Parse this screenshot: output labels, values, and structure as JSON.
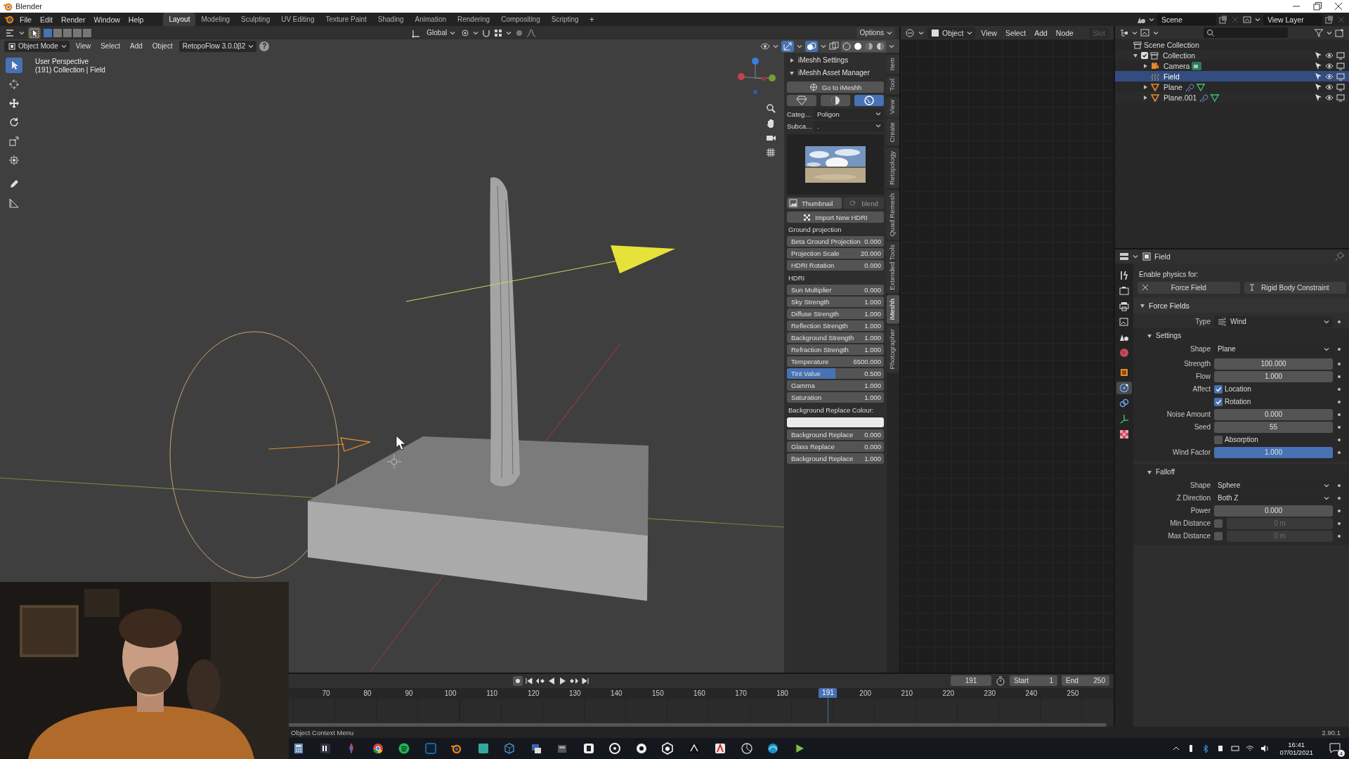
{
  "window": {
    "title": "Blender"
  },
  "menu": [
    "File",
    "Edit",
    "Render",
    "Window",
    "Help"
  ],
  "workspaces": [
    {
      "label": "Layout",
      "selected": true
    },
    {
      "label": "Modeling",
      "selected": false
    },
    {
      "label": "Sculpting",
      "selected": false
    },
    {
      "label": "UV Editing",
      "selected": false
    },
    {
      "label": "Texture Paint",
      "selected": false
    },
    {
      "label": "Shading",
      "selected": false
    },
    {
      "label": "Animation",
      "selected": false
    },
    {
      "label": "Rendering",
      "selected": false
    },
    {
      "label": "Compositing",
      "selected": false
    },
    {
      "label": "Scripting",
      "selected": false
    }
  ],
  "add_workspace": "+",
  "scene_selector": {
    "scene": "Scene",
    "view_layer": "View Layer"
  },
  "tool_header": {
    "orientation": "Global",
    "options": "Options"
  },
  "viewport_header": {
    "mode": "Object Mode",
    "menus": [
      "View",
      "Select",
      "Add",
      "Object"
    ],
    "addon": "RetopoFlow 3.0.0β2",
    "help": "?"
  },
  "viewport": {
    "view_name": "User Perspective",
    "collection": "(191) Collection | Field",
    "tools": [
      {
        "kind": "select",
        "selected": true
      },
      {
        "kind": "cursor",
        "selected": false
      },
      {
        "kind": "move",
        "selected": false
      },
      {
        "kind": "rotate",
        "selected": false
      },
      {
        "kind": "scale",
        "selected": false
      },
      {
        "kind": "transform",
        "selected": false
      },
      {
        "kind": "annotate",
        "selected": false
      },
      {
        "kind": "measure",
        "selected": false
      }
    ]
  },
  "sidebar": {
    "tabs": [
      {
        "label": "Item",
        "selected": false
      },
      {
        "label": "Tool",
        "selected": false
      },
      {
        "label": "View",
        "selected": false
      },
      {
        "label": "Create",
        "selected": false
      },
      {
        "label": "Retopology",
        "selected": false
      },
      {
        "label": "Quad Remesh",
        "selected": false
      },
      {
        "label": "Extended Tools",
        "selected": false
      },
      {
        "label": "iMeshh",
        "selected": true
      },
      {
        "label": "Photographer",
        "selected": false
      }
    ],
    "panels": [
      {
        "title": "iMeshh Settings",
        "expanded": false
      },
      {
        "title": "iMeshh Asset Manager",
        "expanded": true
      }
    ],
    "go_button": "Go to iMeshh",
    "asset_types": [
      {
        "kind": "model",
        "selected": false
      },
      {
        "kind": "material",
        "selected": false
      },
      {
        "kind": "hdri",
        "selected": true
      }
    ],
    "category": {
      "label": "Categ…",
      "value": "Poligon"
    },
    "subcategory": {
      "label": "Subca…",
      "value": "."
    },
    "thumbnail": {
      "kind": "picture",
      "label": "Thumbnail"
    },
    "blend": {
      "label": "blend",
      "disabled": true
    },
    "import_button": "Import New HDRI",
    "sections": [
      {
        "title": "Ground projection",
        "fields": [
          {
            "kind": "number",
            "label": "Beta Ground Projection",
            "value": "0.000"
          },
          {
            "kind": "number",
            "label": "Projection Scale",
            "value": "20.000"
          },
          {
            "kind": "number",
            "label": "HDRI Rotation",
            "value": "0.000"
          }
        ]
      },
      {
        "title": "HDRI",
        "fields": [
          {
            "kind": "number",
            "label": "Sun Multiplier",
            "value": "0.000"
          },
          {
            "kind": "number",
            "label": "Sky Strength",
            "value": "1.000"
          },
          {
            "kind": "number",
            "label": "Diffuse Strength",
            "value": "1.000"
          },
          {
            "kind": "number",
            "label": "Reflection Strength",
            "value": "1.000"
          },
          {
            "kind": "number",
            "label": "Background Strength",
            "value": "1.000"
          },
          {
            "kind": "number",
            "label": "Refraction Strength",
            "value": "1.000"
          },
          {
            "kind": "number",
            "label": "Temperature",
            "value": "6500.000"
          },
          {
            "kind": "slider",
            "label": "Tint Value",
            "value": "0.500",
            "level": 0.5
          },
          {
            "kind": "number",
            "label": "Gamma",
            "value": "1.000"
          },
          {
            "kind": "number",
            "label": "Saturation",
            "value": "1.000"
          }
        ]
      },
      {
        "title": "Background Replace Colour:",
        "color": "#ebebeb",
        "fields": [
          {
            "kind": "number",
            "label": "Background Replace",
            "value": "0.000"
          },
          {
            "kind": "number",
            "label": "Glass Replace",
            "value": "0.000"
          },
          {
            "kind": "number",
            "label": "Background Replace",
            "value": "1.000"
          }
        ]
      }
    ]
  },
  "node_header": {
    "mode": "Object",
    "menus": [
      "View",
      "Select",
      "Add",
      "Node"
    ],
    "slot": "Slot"
  },
  "outliner": {
    "root": "Scene Collection",
    "items": [
      {
        "name": "Collection",
        "kind": "collection",
        "checked": true,
        "expanded": true,
        "selected": false,
        "children": [
          {
            "name": "Camera",
            "kind": "camera",
            "expanded": false,
            "selected": false
          },
          {
            "name": "Field",
            "kind": "field",
            "selected": true
          },
          {
            "name": "Plane",
            "kind": "mesh",
            "expanded": false,
            "selected": false
          },
          {
            "name": "Plane.001",
            "kind": "mesh",
            "expanded": false,
            "selected": false
          }
        ]
      }
    ]
  },
  "properties": {
    "object": "Field",
    "tabs": [
      {
        "kind": "tool",
        "selected": false
      },
      {
        "kind": "render",
        "selected": false
      },
      {
        "kind": "output",
        "selected": false
      },
      {
        "kind": "view_layer",
        "selected": false
      },
      {
        "kind": "scene",
        "selected": false
      },
      {
        "kind": "world",
        "selected": false
      },
      {
        "kind": "object",
        "selected": false
      },
      {
        "kind": "physics",
        "selected": true
      },
      {
        "kind": "constraints",
        "selected": false
      },
      {
        "kind": "data",
        "selected": false
      },
      {
        "kind": "texture",
        "selected": false
      }
    ],
    "enable_label": "Enable physics for:",
    "physics_buttons": [
      {
        "kind": "remove",
        "label": "Force Field"
      },
      {
        "kind": "add",
        "label": "Rigid Body Constraint"
      }
    ],
    "panel": {
      "title": "Force Fields",
      "expanded": true,
      "rows": [
        {
          "kind": "icon_dropdown",
          "label": "Type",
          "value": "Wind"
        }
      ],
      "subpanels": [
        {
          "title": "Settings",
          "expanded": true,
          "rows": [
            {
              "kind": "dropdown",
              "label": "Shape",
              "value": "Plane"
            },
            {
              "kind": "number",
              "label": "Strength",
              "value": "100.000"
            },
            {
              "kind": "number",
              "label": "Flow",
              "value": "1.000"
            },
            {
              "kind": "checkbox",
              "label": "Affect",
              "text": "Location",
              "checked": true
            },
            {
              "kind": "checkbox",
              "text": "Rotation",
              "checked": true
            },
            {
              "kind": "number",
              "label": "Noise Amount",
              "value": "0.000"
            },
            {
              "kind": "number",
              "label": "Seed",
              "value": "55"
            },
            {
              "kind": "checkbox",
              "text": "Absorption",
              "checked": false
            },
            {
              "kind": "slider",
              "label": "Wind Factor",
              "value": "1.000",
              "level": 1
            }
          ]
        },
        {
          "title": "Falloff",
          "expanded": true,
          "rows": [
            {
              "kind": "dropdown",
              "label": "Shape",
              "value": "Sphere"
            },
            {
              "kind": "dropdown",
              "label": "Z Direction",
              "value": "Both Z"
            },
            {
              "kind": "number",
              "label": "Power",
              "value": "0.000"
            },
            {
              "kind": "toggle_number",
              "label": "Min Distance",
              "checked": false,
              "value": "0 m"
            },
            {
              "kind": "toggle_number",
              "label": "Max Distance",
              "checked": false,
              "value": "0 m"
            }
          ]
        }
      ]
    }
  },
  "timeline": {
    "current": "191",
    "start_label": "Start",
    "start": "1",
    "end_label": "End",
    "end": "250",
    "ticks_before_playhead": [
      "70",
      "80",
      "90",
      "100",
      "110",
      "120",
      "130",
      "140",
      "150",
      "160",
      "170",
      "180"
    ],
    "ticks_after_playhead": [
      "200",
      "210",
      "220",
      "230",
      "240",
      "250"
    ],
    "playhead": {
      "label": "191",
      "level": 0.7435
    }
  },
  "webcam": {
    "kind": "picture"
  },
  "status_bar": {
    "message": "Object Context Menu",
    "version": "2.90.1"
  },
  "taskbar": {
    "time": "16:41",
    "date": "07/01/2021",
    "notifications": "4"
  }
}
